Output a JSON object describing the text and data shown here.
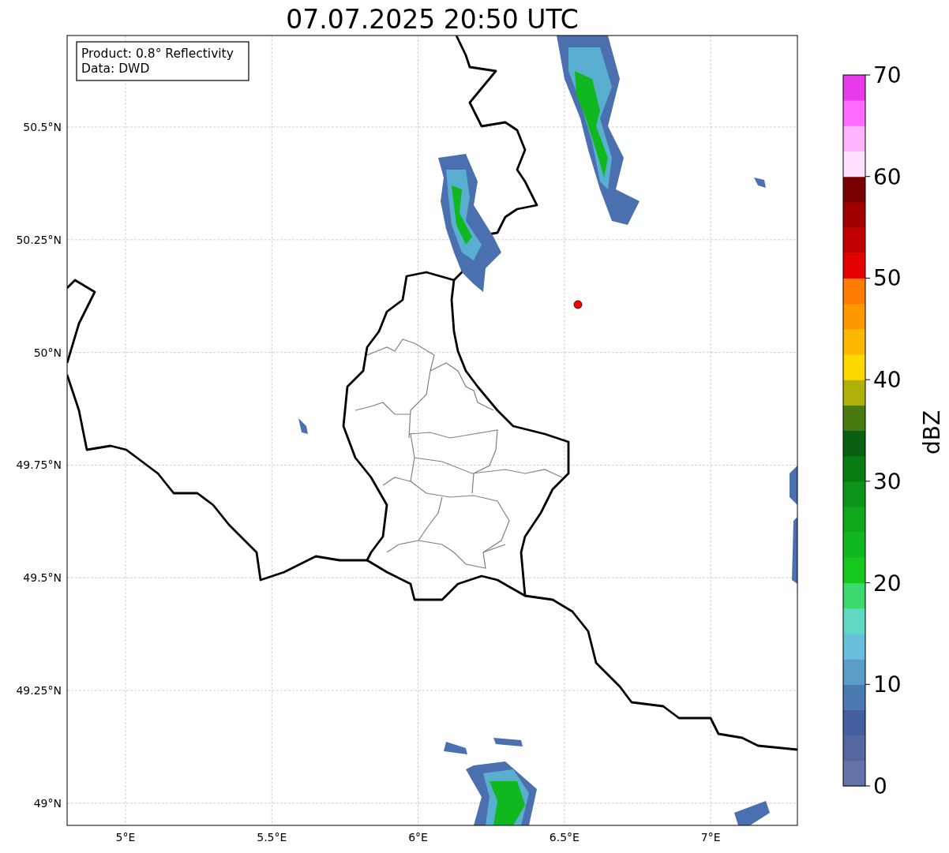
{
  "title": "07.07.2025 20:50 UTC",
  "info_box": [
    "Product: 0.8° Reflectivity",
    "Data: DWD"
  ],
  "lat_labels": [
    "50.5°N",
    "50.25°N",
    "50°N",
    "49.75°N",
    "49.5°N",
    "49.25°N",
    "49°N"
  ],
  "lon_labels": [
    "5°E",
    "5.5°E",
    "6°E",
    "6.5°E",
    "7°E"
  ],
  "colorbar": {
    "label": "dBZ",
    "ticks": [
      "70",
      "60",
      "50",
      "40",
      "30",
      "20",
      "10",
      "0"
    ],
    "bands": [
      {
        "color": "#6574a8"
      },
      {
        "color": "#5567a0"
      },
      {
        "color": "#4560a0"
      },
      {
        "color": "#4a7ab0"
      },
      {
        "color": "#5a9ec8"
      },
      {
        "color": "#68c0dc"
      },
      {
        "color": "#60d8c4"
      },
      {
        "color": "#3ed870"
      },
      {
        "color": "#14c81e"
      },
      {
        "color": "#10b820"
      },
      {
        "color": "#0ea81a"
      },
      {
        "color": "#0c9418"
      },
      {
        "color": "#0a7c14"
      },
      {
        "color": "#086010"
      },
      {
        "color": "#487a10"
      },
      {
        "color": "#b0b008"
      },
      {
        "color": "#ffd800"
      },
      {
        "color": "#ffb800"
      },
      {
        "color": "#ff9800"
      },
      {
        "color": "#ff7c00"
      },
      {
        "color": "#e40000"
      },
      {
        "color": "#c00000"
      },
      {
        "color": "#a00000"
      },
      {
        "color": "#780000"
      },
      {
        "color": "#ffe0ff"
      },
      {
        "color": "#ffb4ff"
      },
      {
        "color": "#ff6cff"
      },
      {
        "color": "#e83cec"
      }
    ]
  }
}
